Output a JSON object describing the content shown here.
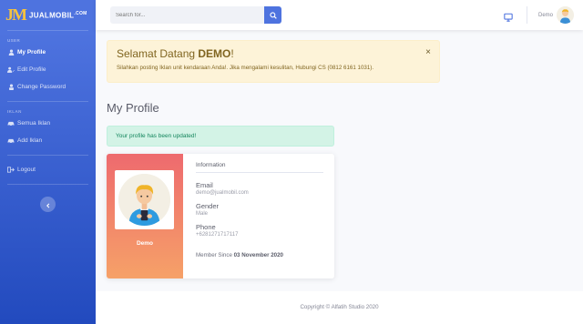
{
  "brand": {
    "logo": "JM",
    "name": "JUALMOBIL",
    "suffix": ".COM"
  },
  "sidebar": {
    "section_user": "USER",
    "user_items": [
      {
        "label": "My Profile",
        "icon": "user-icon",
        "active": true
      },
      {
        "label": "Edit Profile",
        "icon": "user-edit-icon"
      },
      {
        "label": "Change Password",
        "icon": "key-icon"
      }
    ],
    "section_ads": "IKLAN",
    "ads_items": [
      {
        "label": "Semua Iklan",
        "icon": "car-icon"
      },
      {
        "label": "Add Iklan",
        "icon": "car-add-icon"
      }
    ],
    "logout_label": "Logout"
  },
  "topbar": {
    "search_placeholder": "Search for...",
    "user_name": "Demo"
  },
  "welcome": {
    "title_prefix": "Selamat Datang ",
    "title_name": "DEMO",
    "title_suffix": "!",
    "message": "Silahkan posting Iklan unit kendaraan Anda!. Jika mengalami kesulitan, Hubungi CS (0812 6161 1031).",
    "close": "×"
  },
  "page_title": "My Profile",
  "success_message": "Your profile has been updated!",
  "profile": {
    "name": "Demo",
    "info_heading": "Information",
    "email_label": "Email",
    "email": "demo@jualmobil.com",
    "gender_label": "Gender",
    "gender": "Male",
    "phone_label": "Phone",
    "phone": "+6281271717117",
    "member_since_label": "Member Since ",
    "member_since": "03 November 2020"
  },
  "footer": "Copyright © Alfatih Studio 2020",
  "colors": {
    "primary": "#4e73df",
    "warning_bg": "#fdf3d8",
    "success_bg": "#d3f3e6",
    "card_gradient_top": "#ee6a6e",
    "card_gradient_bottom": "#f6a168"
  }
}
